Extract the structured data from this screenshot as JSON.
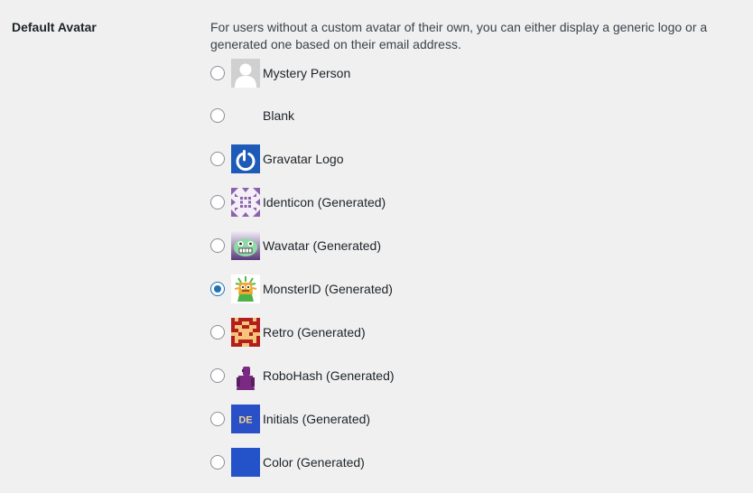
{
  "setting": {
    "label": "Default Avatar",
    "description": "For users without a custom avatar of their own, you can either display a generic logo or a generated one based on their email address."
  },
  "options": [
    {
      "label": "Mystery Person",
      "icon": "mystery-person-icon",
      "checked": false
    },
    {
      "label": "Blank",
      "icon": "blank-icon",
      "checked": false
    },
    {
      "label": "Gravatar Logo",
      "icon": "gravatar-logo-icon",
      "checked": false
    },
    {
      "label": "Identicon (Generated)",
      "icon": "identicon-icon",
      "checked": false
    },
    {
      "label": "Wavatar (Generated)",
      "icon": "wavatar-icon",
      "checked": false
    },
    {
      "label": "MonsterID (Generated)",
      "icon": "monsterid-icon",
      "checked": true
    },
    {
      "label": "Retro (Generated)",
      "icon": "retro-icon",
      "checked": false
    },
    {
      "label": "RoboHash (Generated)",
      "icon": "robohash-icon",
      "checked": false
    },
    {
      "label": "Initials (Generated)",
      "icon": "initials-icon",
      "checked": false,
      "initials": "DE"
    },
    {
      "label": "Color (Generated)",
      "icon": "color-icon",
      "checked": false
    }
  ],
  "colors": {
    "accent": "#2271b1",
    "gravatar_blue": "#1e5bb8",
    "initials_bg": "#2a50c8",
    "color_avatar": "#2352c9"
  }
}
